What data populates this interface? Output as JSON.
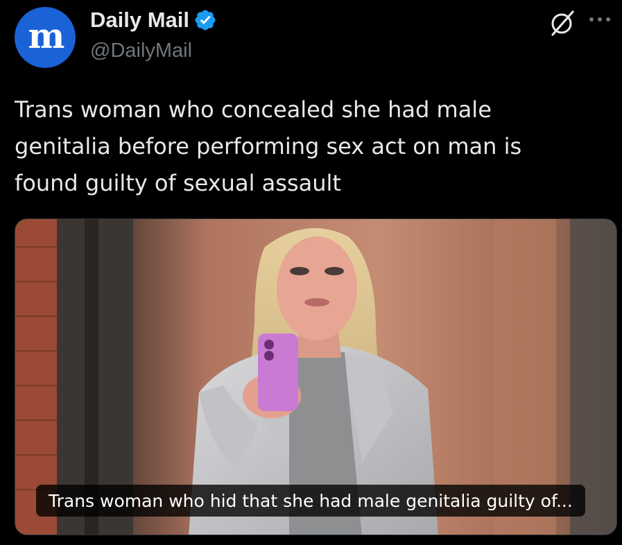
{
  "author": {
    "display_name": "Daily Mail",
    "handle": "@DailyMail",
    "avatar_icon": "daily-mail-logo-icon",
    "verified": true,
    "verified_color": "#1d9bf0",
    "avatar_color": "#1a62d6"
  },
  "actions": {
    "grok_icon": "grok-icon",
    "more_icon": "more-options-icon"
  },
  "tweet": {
    "text": "Trans woman who concealed she had male\ngenitalia before performing sex act on man is\nfound guilty of sexual assault"
  },
  "media": {
    "caption": "Trans woman who hid that she had male genitalia guilty of..."
  }
}
